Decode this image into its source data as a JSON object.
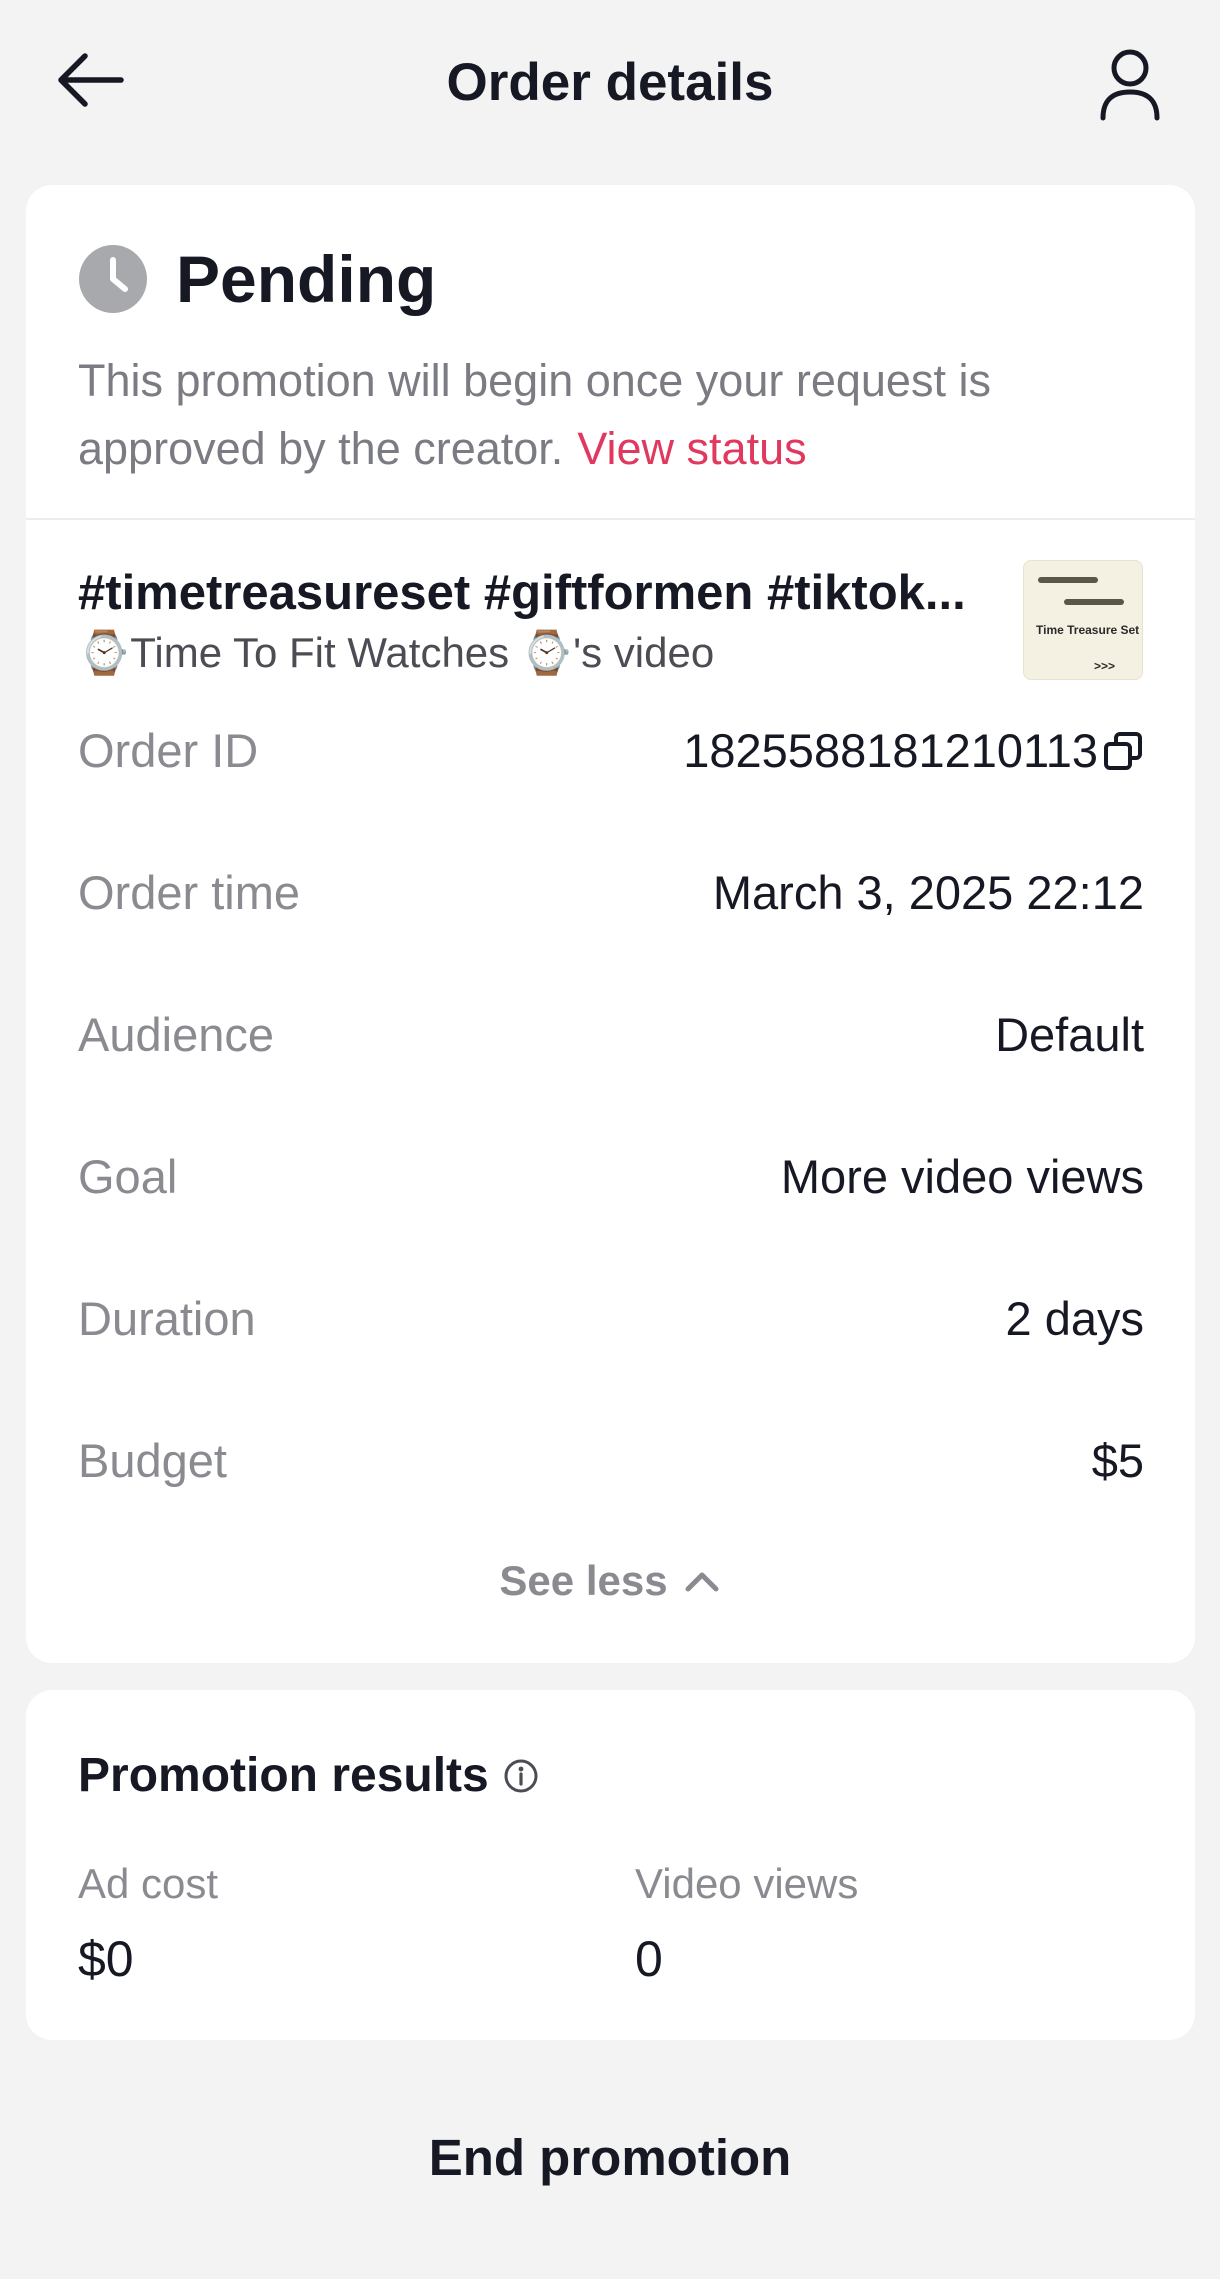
{
  "header": {
    "title": "Order details",
    "back_icon": "arrow-left-icon",
    "profile_icon": "person-icon"
  },
  "status": {
    "icon": "clock-icon",
    "title": "Pending",
    "description": "This promotion will begin once your request is approved by the creator.",
    "link": "View status"
  },
  "video": {
    "title": "#timetreasureset #giftformen #tiktok...",
    "subtitle": "⌚Time To Fit Watches ⌚'s video",
    "thumbnail_text": "Time Treasure Set",
    "thumbnail_arrow": ">>>"
  },
  "details": [
    {
      "label": "Order ID",
      "value": "1825588181210113"
    },
    {
      "label": "Order time",
      "value": "March 3, 2025 22:12"
    },
    {
      "label": "Audience",
      "value": "Default"
    },
    {
      "label": "Goal",
      "value": "More video views"
    },
    {
      "label": "Duration",
      "value": "2 days"
    },
    {
      "label": "Budget",
      "value": "$5"
    }
  ],
  "see_less": "See less",
  "results": {
    "title": "Promotion results",
    "metrics": [
      {
        "label": "Ad cost",
        "value": "$0"
      },
      {
        "label": "Video views",
        "value": "0"
      }
    ]
  },
  "end_button": "End promotion",
  "colors": {
    "accent": "#e0385e",
    "background": "#f3f3f4",
    "card": "#ffffff",
    "text": "#161823",
    "muted": "#8a8b91"
  }
}
